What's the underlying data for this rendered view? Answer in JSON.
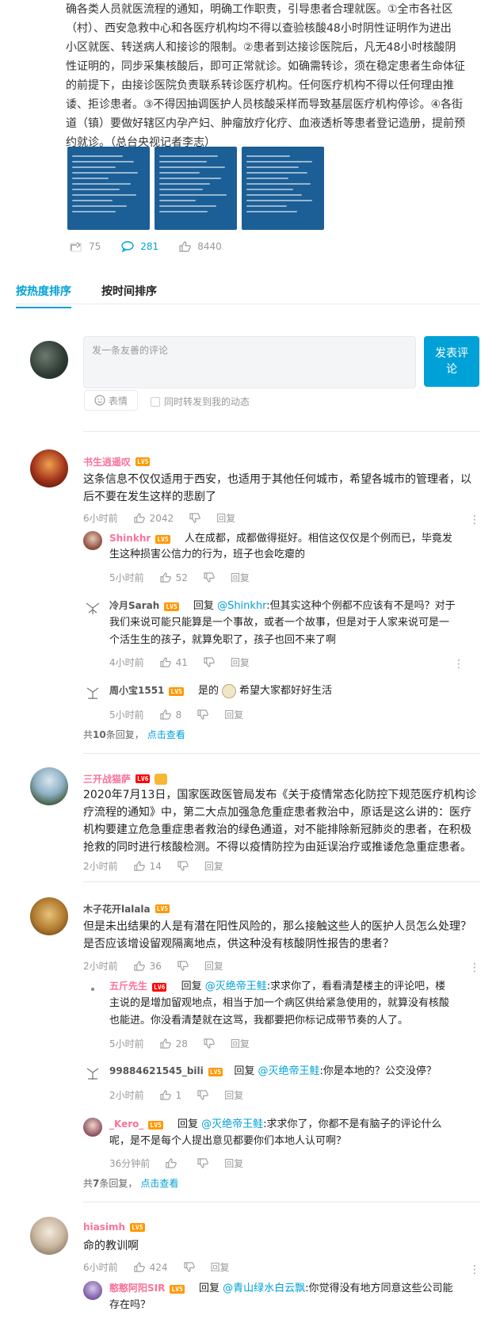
{
  "post": {
    "lines": [
      "确各类人员就医流程的通知，明确工作职责，引导患者合理就医。①全市各社区",
      "（村）、西安急救中心和各医疗机构均不得以查验核酸48小时阴性证明作为进出",
      "小区就医、转送病人和接诊的限制。②患者到达接诊医院后，凡无48小时核酸阴",
      "性证明的，同步采集核酸后，即可正常就诊。如确需转诊，须在稳定患者生命体征",
      "的前提下，由接诊医院负责联系转诊医疗机构。任何医疗机构不得以任何理由推",
      "诿、拒诊患者。③不得因抽调医护人员核酸采样而导致基层医疗机构停诊。④各街",
      "道（镇）要做好辖区内孕产妇、肿瘤放疗化疗、血液透析等患者登记造册，提前预",
      "约就诊。（总台央视记者李志）"
    ],
    "forward_count": "75",
    "comment_count": "281",
    "like_count": "8440"
  },
  "sort": {
    "hot": "按热度排序",
    "time": "按时间排序"
  },
  "composer": {
    "placeholder": "发一条友善的评论",
    "send": "发表评论",
    "emoji": "表情",
    "forward": "同时转发到我的动态"
  },
  "comments": [
    {
      "user": "书生逍遥叹",
      "level": "LV5",
      "lines": [
        "这条信息不仅仅适用于西安，也适用于其他任何城市，希望各城市的管理者，以",
        "后不要在发生这样的悲剧了"
      ],
      "time": "6小时前",
      "likes": "2042",
      "reply_label": "回复",
      "replies": [
        {
          "user": "Shinkhr",
          "level": "LV5",
          "lines": [
            "人在成都，成都做得挺好。相信这仅仅是个例而已，毕竟发",
            "生这种损害公信力的行为，班子也会吃瘪的"
          ],
          "time": "5小时前",
          "likes": "52"
        },
        {
          "user": "冷月Sarah",
          "level": "LV5",
          "reply_word": "回复",
          "at": "@Shinkhr",
          "lines": [
            ":但其实这种个例都不应该有不是吗？对于",
            "我们来说可能只能算是一个事故，或者一个故事，但是对于人家来说可是一",
            "个活生生的孩子，就算免职了，孩子也回不来了啊"
          ],
          "time": "4小时前",
          "likes": "41"
        },
        {
          "user": "周小宝1551",
          "level": "LV5",
          "lines_a": "是的",
          "lines_b": "希望大家都好好生活",
          "time": "5小时前",
          "likes": "8"
        }
      ],
      "total_pre": "共",
      "total_num": "10",
      "total_post": "条回复，",
      "view_more": "点击查看"
    },
    {
      "user": "三开战猫萨",
      "level": "LV6",
      "lines": [
        "2020年7月13日，国家医政医管局发布《关于疫情常态化防控下规范医疗机构诊",
        "疗流程的通知》中，第二大点加强急危重症患者救治中，原话是这么讲的：医疗",
        "机构要建立危急重症患者救治的绿色通道，对不能排除新冠肺炎的患者，在积极",
        "抢救的同时进行核酸检测。不得以疫情防控为由延误治疗或推诿危急重症患者。"
      ],
      "time": "2小时前",
      "likes": "14",
      "reply_label": "回复"
    },
    {
      "user": "木子花开lalala",
      "level": "LV5",
      "lines": [
        "但是未出结果的人是有潜在阳性风险的，那么接触这些人的医护人员怎么处理？",
        "是否应该增设留观隔离地点，供这种没有核酸阴性报告的患者？"
      ],
      "time": "2小时前",
      "likes": "36",
      "reply_label": "回复",
      "replies": [
        {
          "user": "五斤先生",
          "level": "LV6",
          "reply_word": "回复",
          "at": "@灭绝帝王鲑",
          "lines": [
            ":求求你了，看看清楚楼主的评论吧，楼",
            "主说的是增加留观地点，相当于加一个病区供给紧急使用的，就算没有核酸",
            "也能进。你没看清楚就在这骂，我都要把你标记成带节奏的人了。"
          ],
          "time": "5小时前",
          "likes": "28"
        },
        {
          "user": "99884621545_bili",
          "level": "LV5",
          "reply_word": "回复",
          "at": "@灭绝帝王鲑",
          "lines": [
            ":你是本地的？公交没停？"
          ],
          "time": "2小时前",
          "likes": "1"
        },
        {
          "user": "_Kero_",
          "level": "LV5",
          "reply_word": "回复",
          "at": "@灭绝帝王鲑",
          "lines": [
            ":求求你了，你都不是有脑子的评论什么",
            "呢，是不是每个人提出意见都要你们本地人认可啊？"
          ],
          "time": "36分钟前",
          "likes": ""
        }
      ],
      "total_pre": "共",
      "total_num": "7",
      "total_post": "条回复，",
      "view_more": "点击查看"
    },
    {
      "user": "hiasimh",
      "level": "LV5",
      "lines": [
        "命的教训啊"
      ],
      "time": "6小时前",
      "likes": "424",
      "reply_label": "回复",
      "replies": [
        {
          "user": "憨憨阿阳SIR",
          "level": "LV5",
          "reply_word": "回复",
          "at": "@青山绿水白云飘",
          "lines": [
            ":你觉得没有地方同意这些公司能",
            "存在吗？"
          ]
        }
      ]
    }
  ]
}
